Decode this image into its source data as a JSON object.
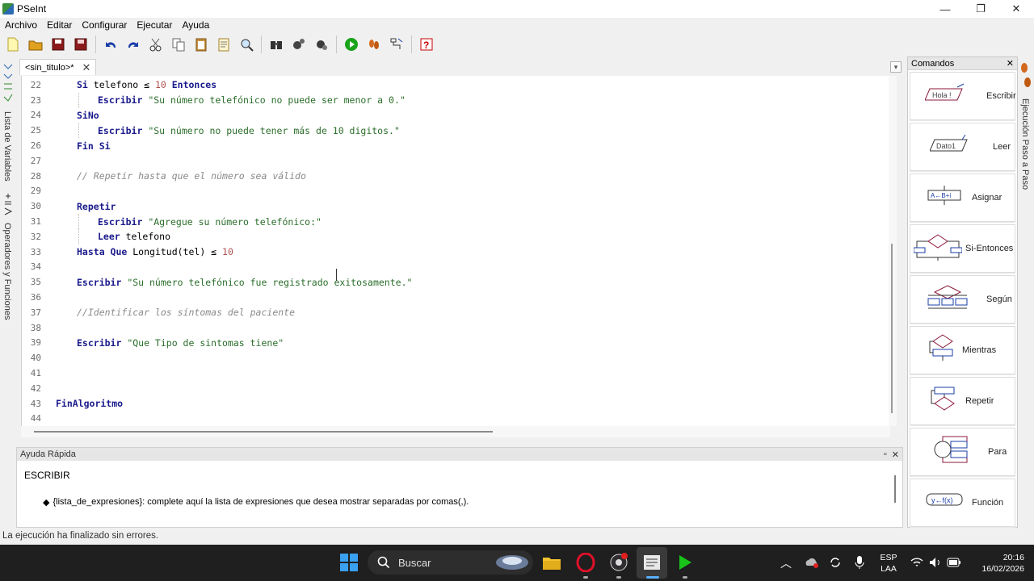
{
  "window": {
    "title": "PSeInt",
    "controls": [
      "—",
      "❐",
      "✕"
    ]
  },
  "menu": [
    "Archivo",
    "Editar",
    "Configurar",
    "Ejecutar",
    "Ayuda"
  ],
  "left_sidebar": {
    "variables_label": "Lista de Variables",
    "operators_label": "Operadores y Funciones"
  },
  "tab": {
    "label": "<sin_titulo>*",
    "close": "✕"
  },
  "editor": {
    "lines": [
      {
        "n": "22",
        "indent": 1,
        "tokens": [
          [
            "kw",
            "Si "
          ],
          [
            "",
            "telefono ≤ "
          ],
          [
            "num",
            "10"
          ],
          [
            "kw",
            " Entonces"
          ]
        ]
      },
      {
        "n": "23",
        "indent": 2,
        "tokens": [
          [
            "kw",
            "Escribir "
          ],
          [
            "str",
            "\"Su número telefónico no puede ser menor a 0.\""
          ]
        ]
      },
      {
        "n": "24",
        "indent": 1,
        "tokens": [
          [
            "kw",
            "SiNo"
          ]
        ]
      },
      {
        "n": "25",
        "indent": 2,
        "tokens": [
          [
            "kw",
            "Escribir "
          ],
          [
            "str",
            "\"Su número no puede tener más de 10 digitos.\""
          ]
        ]
      },
      {
        "n": "26",
        "indent": 1,
        "tokens": [
          [
            "kw",
            "Fin Si"
          ]
        ]
      },
      {
        "n": "27",
        "indent": 0,
        "tokens": []
      },
      {
        "n": "28",
        "indent": 1,
        "tokens": [
          [
            "cmt",
            "// Repetir hasta que el número sea válido"
          ]
        ]
      },
      {
        "n": "29",
        "indent": 0,
        "tokens": []
      },
      {
        "n": "30",
        "indent": 1,
        "tokens": [
          [
            "kw",
            "Repetir"
          ]
        ]
      },
      {
        "n": "31",
        "indent": 2,
        "tokens": [
          [
            "kw",
            "Escribir "
          ],
          [
            "str",
            "\"Agregue su número telefónico:\""
          ]
        ]
      },
      {
        "n": "32",
        "indent": 2,
        "tokens": [
          [
            "kw",
            "Leer "
          ],
          [
            "",
            "telefono"
          ]
        ]
      },
      {
        "n": "33",
        "indent": 1,
        "tokens": [
          [
            "kw",
            "Hasta Que "
          ],
          [
            "",
            "Longitud(tel) ≤ "
          ],
          [
            "num",
            "10"
          ]
        ]
      },
      {
        "n": "34",
        "indent": 0,
        "tokens": []
      },
      {
        "n": "35",
        "indent": 1,
        "tokens": [
          [
            "kw",
            "Escribir "
          ],
          [
            "str",
            "\"Su número telefónico fue registrado exitosamente.\""
          ]
        ]
      },
      {
        "n": "36",
        "indent": 0,
        "tokens": []
      },
      {
        "n": "37",
        "indent": 1,
        "tokens": [
          [
            "cmt",
            "//Identificar los síntomas del paciente"
          ]
        ]
      },
      {
        "n": "38",
        "indent": 0,
        "tokens": []
      },
      {
        "n": "39",
        "indent": 1,
        "tokens": [
          [
            "kw",
            "Escribir "
          ],
          [
            "str",
            "\"Que Tipo de sintomas tiene\""
          ]
        ]
      },
      {
        "n": "40",
        "indent": 0,
        "tokens": []
      },
      {
        "n": "41",
        "indent": 0,
        "tokens": []
      },
      {
        "n": "42",
        "indent": 0,
        "tokens": []
      },
      {
        "n": "43",
        "indent": 0,
        "tokens": [
          [
            "kw",
            "FinAlgoritmo"
          ]
        ]
      },
      {
        "n": "44",
        "indent": 0,
        "tokens": []
      }
    ]
  },
  "commands_panel": {
    "title": "Comandos",
    "close": "✕",
    "items": [
      {
        "label": "Escribir",
        "icon": "write-flow-icon",
        "icon_text": "Hola !"
      },
      {
        "label": "Leer",
        "icon": "read-flow-icon",
        "icon_text": "Dato1"
      },
      {
        "label": "Asignar",
        "icon": "assign-flow-icon",
        "icon_text": "A←B+i"
      },
      {
        "label": "Si-Entonces",
        "icon": "if-flow-icon"
      },
      {
        "label": "Según",
        "icon": "switch-flow-icon"
      },
      {
        "label": "Mientras",
        "icon": "while-flow-icon"
      },
      {
        "label": "Repetir",
        "icon": "repeat-flow-icon"
      },
      {
        "label": "Para",
        "icon": "for-flow-icon"
      },
      {
        "label": "Función",
        "icon": "function-flow-icon",
        "icon_text": "y←f(x)"
      }
    ]
  },
  "right_sidebar": {
    "label": "Ejecución Paso a Paso"
  },
  "help": {
    "title": "Ayuda Rápida",
    "heading": "ESCRIBIR",
    "bullet": "{lista_de_expresiones}: complete aquí la lista de expresiones que desea mostrar separadas por comas(,)."
  },
  "status": "La ejecución ha finalizado sin errores.",
  "taskbar": {
    "search_placeholder": "Buscar",
    "lang_top": "ESP",
    "lang_bottom": "LAA",
    "time": "20:16",
    "date": "16/02/2026"
  }
}
